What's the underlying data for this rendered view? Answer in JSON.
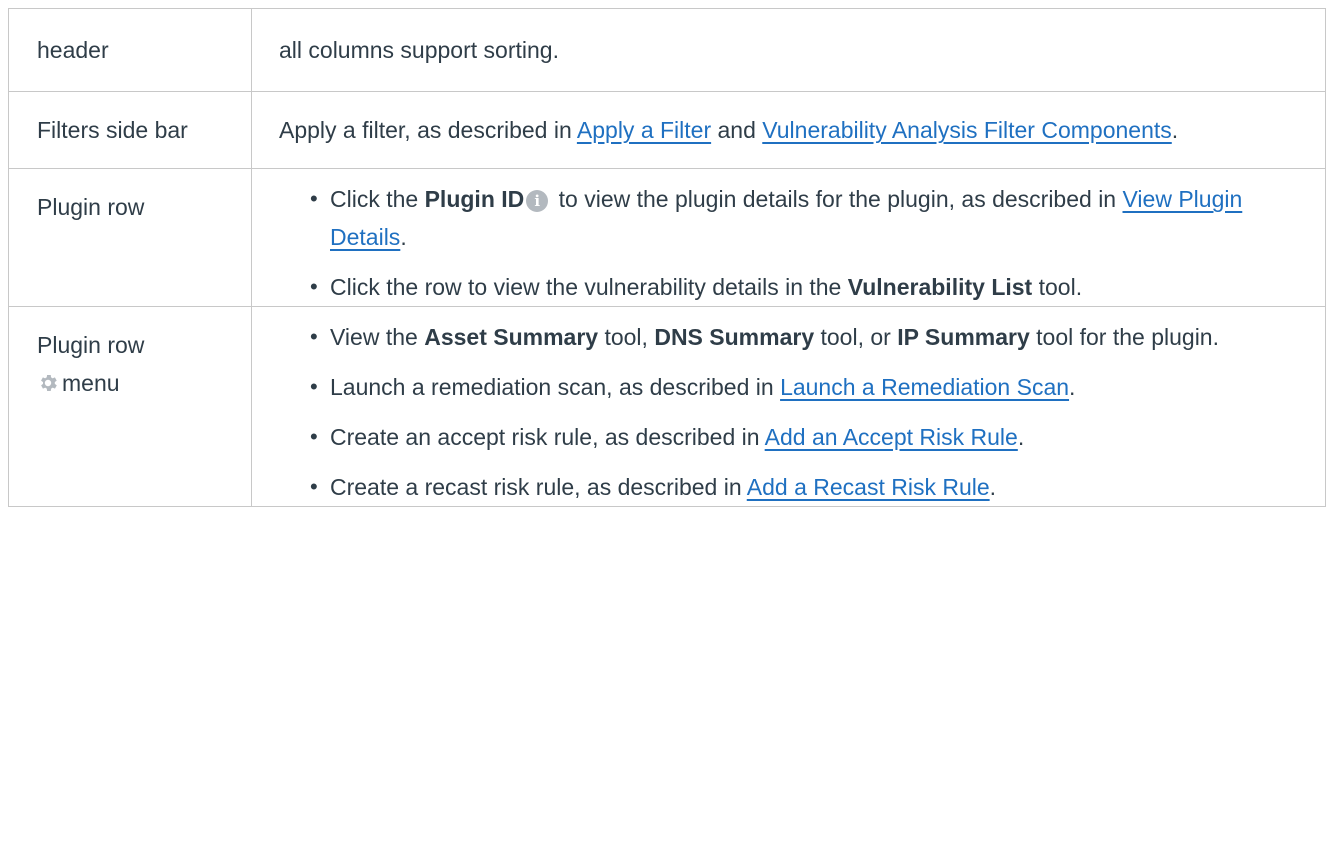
{
  "rows": [
    {
      "label": "header",
      "text": "all columns support sorting."
    },
    {
      "label": "Filters side bar",
      "prefix": "Apply a filter, as described in ",
      "link1": "Apply a Filter",
      "middle": " and ",
      "link2": "Vulnerability Analysis Filter Components",
      "suffix": "."
    },
    {
      "label": "Plugin row",
      "items": [
        {
          "pre": "Click the ",
          "bold": "Plugin ID",
          "icon": "info-icon",
          "post": " to view the plugin details for the plugin, as described in ",
          "link": "View Plugin Details",
          "end": "."
        },
        {
          "pre": "Click the row to view the vulnerability details in the ",
          "bold": "Vulnerability List",
          "post": " tool."
        }
      ]
    },
    {
      "label_line1": "Plugin row",
      "label_icon": "gear-icon",
      "label_line2": "menu",
      "items": [
        {
          "pre": "View the ",
          "bold1": "Asset Summary",
          "mid1": " tool, ",
          "bold2": "DNS Summary",
          "mid2": " tool, or ",
          "bold3": "IP Summary",
          "post": " tool for the plugin."
        },
        {
          "pre": "Launch a remediation scan, as described in ",
          "link": "Launch a Remediation Scan",
          "end": "."
        },
        {
          "pre": "Create an accept risk rule, as described in ",
          "link": "Add an Accept Risk Rule",
          "end": "."
        },
        {
          "pre": "Create a recast risk rule, as described in ",
          "link": "Add a Recast Risk Rule",
          "end": "."
        }
      ]
    }
  ],
  "colors": {
    "text": "#2f3d48",
    "link": "#1f70c1",
    "border": "#c8c8c8",
    "icon": "#b3b9bf"
  }
}
